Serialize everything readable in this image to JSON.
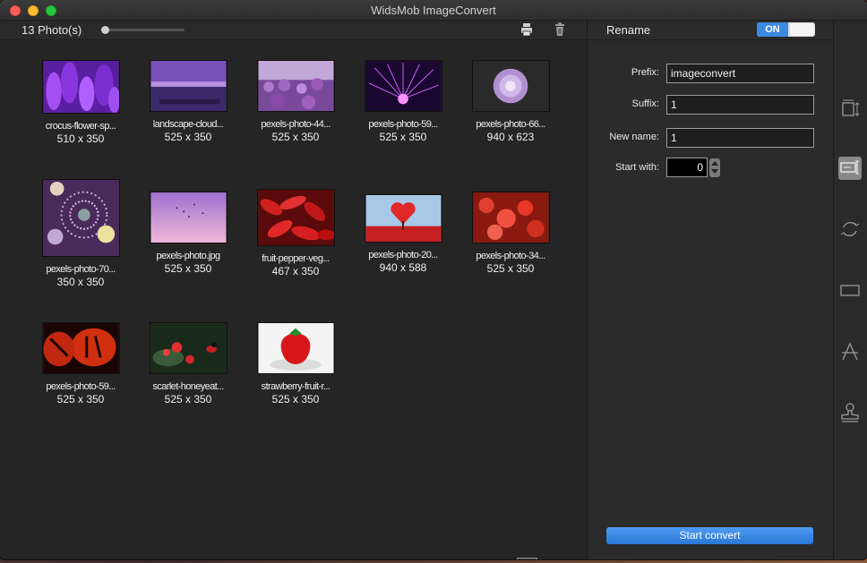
{
  "window": {
    "title": "WidsMob ImageConvert"
  },
  "toolbar": {
    "photo_count": "13 Photo(s)",
    "zoom_level": 0.0
  },
  "photos": [
    {
      "name": "crocus-flower-sp...",
      "dim": "510 x 350"
    },
    {
      "name": "landscape-cloud...",
      "dim": "525 x 350"
    },
    {
      "name": "pexels-photo-44...",
      "dim": "525 x 350"
    },
    {
      "name": "pexels-photo-59...",
      "dim": "525 x 350"
    },
    {
      "name": "pexels-photo-66...",
      "dim": "940 x 623"
    },
    {
      "name": "pexels-photo-70...",
      "dim": "350 x 350"
    },
    {
      "name": "pexels-photo.jpg",
      "dim": "525 x 350"
    },
    {
      "name": "fruit-pepper-veg...",
      "dim": "467 x 350"
    },
    {
      "name": "pexels-photo-20...",
      "dim": "940 x 588"
    },
    {
      "name": "pexels-photo-34...",
      "dim": "525 x 350"
    },
    {
      "name": "pexels-photo-59...",
      "dim": "525 x 350"
    },
    {
      "name": "scarlet-honeyeat...",
      "dim": "525 x 350"
    },
    {
      "name": "strawberry-fruit-r...",
      "dim": "525 x 350"
    }
  ],
  "panel": {
    "title": "Rename",
    "toggle_label": "ON",
    "prefix_label": "Prefix:",
    "prefix_value": "imageconvert",
    "suffix_label": "Suffix:",
    "suffix_value": "1",
    "newname_label": "New name:",
    "newname_value": "1",
    "startwith_label": "Start with:",
    "startwith_value": "0",
    "start_button": "Start convert"
  },
  "sidebar_icons": [
    "resize-icon",
    "rename-icon",
    "rotate-icon",
    "crop-icon",
    "text-watermark-icon",
    "stamp-icon"
  ],
  "colors": {
    "accent": "#3d88e0",
    "window_bg": "#262626",
    "panel_bg": "#2b2b2b"
  }
}
